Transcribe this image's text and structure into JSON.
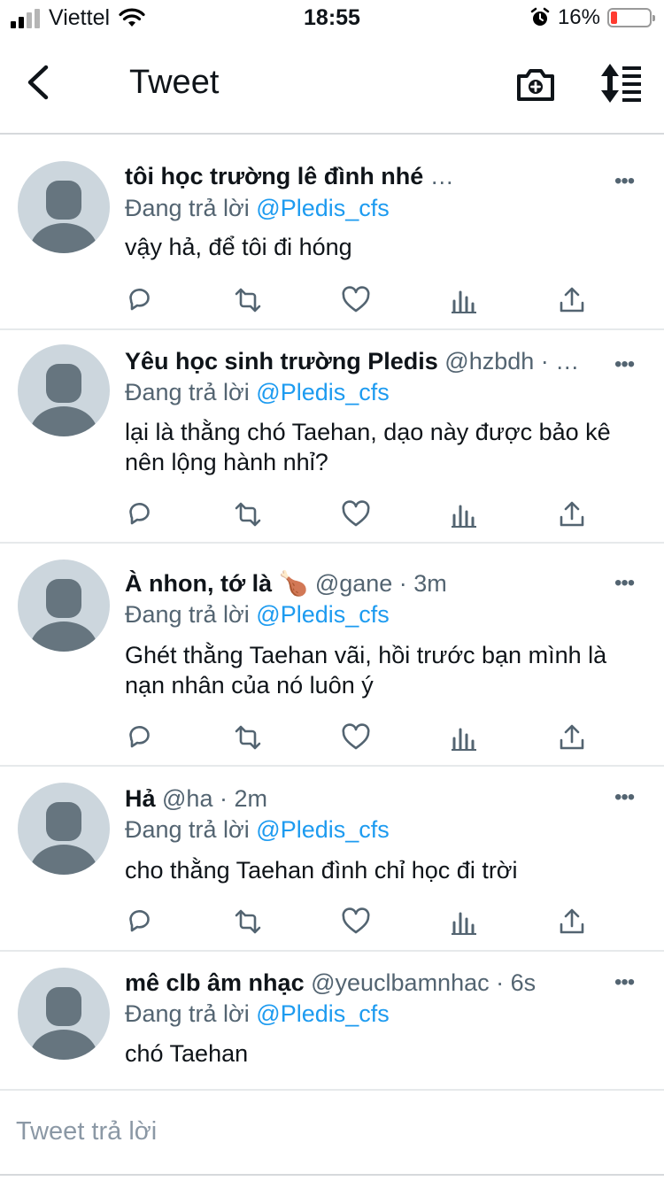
{
  "status_bar": {
    "carrier": "Viettel",
    "time": "18:55",
    "battery": "16%",
    "battery_level": 0.16
  },
  "nav": {
    "title": "Tweet",
    "icons": [
      "back-chevron-icon",
      "camera-plus-icon",
      "sort-timeline-icon"
    ]
  },
  "reply_prefix": "Đang trả lời",
  "tweets": [
    {
      "name": "tôi học trường lê đình nhé",
      "meta": " …",
      "reply_to": "@Pledis_cfs",
      "text": "vậy hả, để tôi đi hóng"
    },
    {
      "name": "Yêu học sinh trường Pledis",
      "meta": " @hzbdh · …",
      "reply_to": "@Pledis_cfs",
      "text": "lại là thằng chó Taehan, dạo này được bảo kê nên lộng hành nhỉ?"
    },
    {
      "name": "À nhon, tớ là 🍗",
      "meta": "  @gane · 3m",
      "reply_to": "@Pledis_cfs",
      "text": "Ghét thằng Taehan vãi, hồi trước bạn mình là nạn nhân của nó luôn ý"
    },
    {
      "name": "Hả",
      "meta": " @ha · 2m",
      "reply_to": "@Pledis_cfs",
      "text": "cho thằng Taehan đình chỉ học đi trời"
    },
    {
      "name": "mê clb âm nhạc",
      "meta": "  @yeuclbamnhac · 6s",
      "reply_to": "@Pledis_cfs",
      "text": "chó Taehan"
    }
  ],
  "more_label": "•••",
  "reply_box": {
    "placeholder": "Tweet trả lời"
  },
  "colors": {
    "link": "#1d9bf0",
    "meta": "#536471",
    "avatar_bg": "#ccd6dd",
    "avatar_fg": "#66757f"
  }
}
